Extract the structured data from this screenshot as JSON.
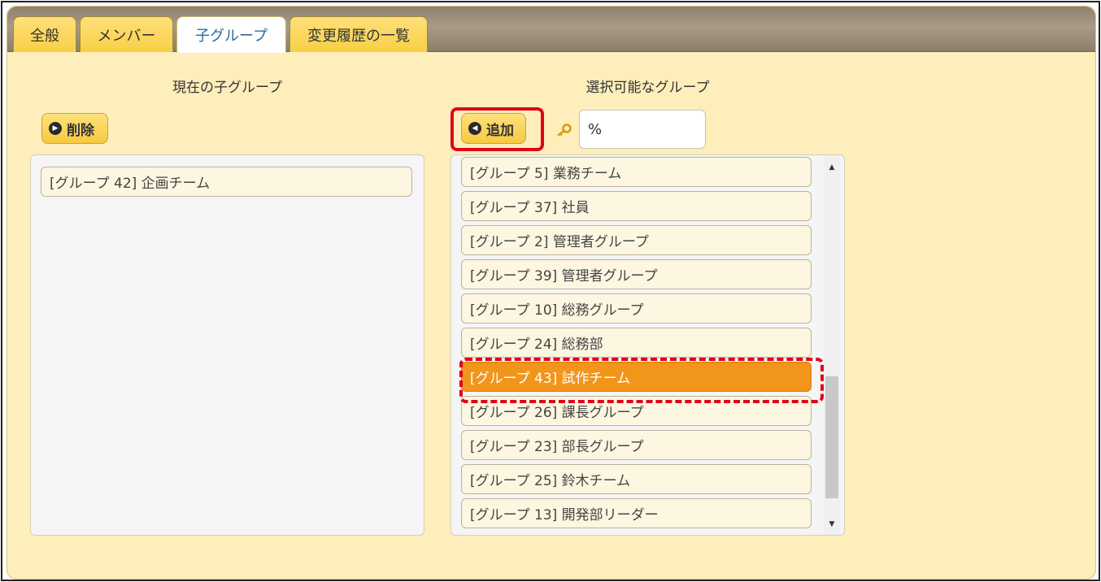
{
  "tabs": [
    {
      "label": "全般",
      "active": false
    },
    {
      "label": "メンバー",
      "active": false
    },
    {
      "label": "子グループ",
      "active": true
    },
    {
      "label": "変更履歴の一覧",
      "active": false
    }
  ],
  "left": {
    "title": "現在の子グループ",
    "remove_label": "削除",
    "items": [
      "[グループ 42] 企画チーム"
    ]
  },
  "right": {
    "title": "選択可能なグループ",
    "add_label": "追加",
    "search_value": "%",
    "items": [
      "[グループ 5] 業務チーム",
      "[グループ 37] 社員",
      "[グループ 2] 管理者グループ",
      "[グループ 39] 管理者グループ",
      "[グループ 10] 総務グループ",
      "[グループ 24] 総務部",
      "[グループ 43] 試作チーム",
      "[グループ 26] 課長グループ",
      "[グループ 23] 部長グループ",
      "[グループ 25] 鈴木チーム",
      "[グループ 13] 開発部リーダー"
    ],
    "selected_index": 6
  },
  "colors": {
    "panel": "#fdeebb",
    "selected": "#f2951b",
    "highlight": "#e0001a"
  },
  "icons": {
    "remove": "arrow-right-circle-icon",
    "add": "arrow-left-circle-icon",
    "search": "key-icon"
  }
}
